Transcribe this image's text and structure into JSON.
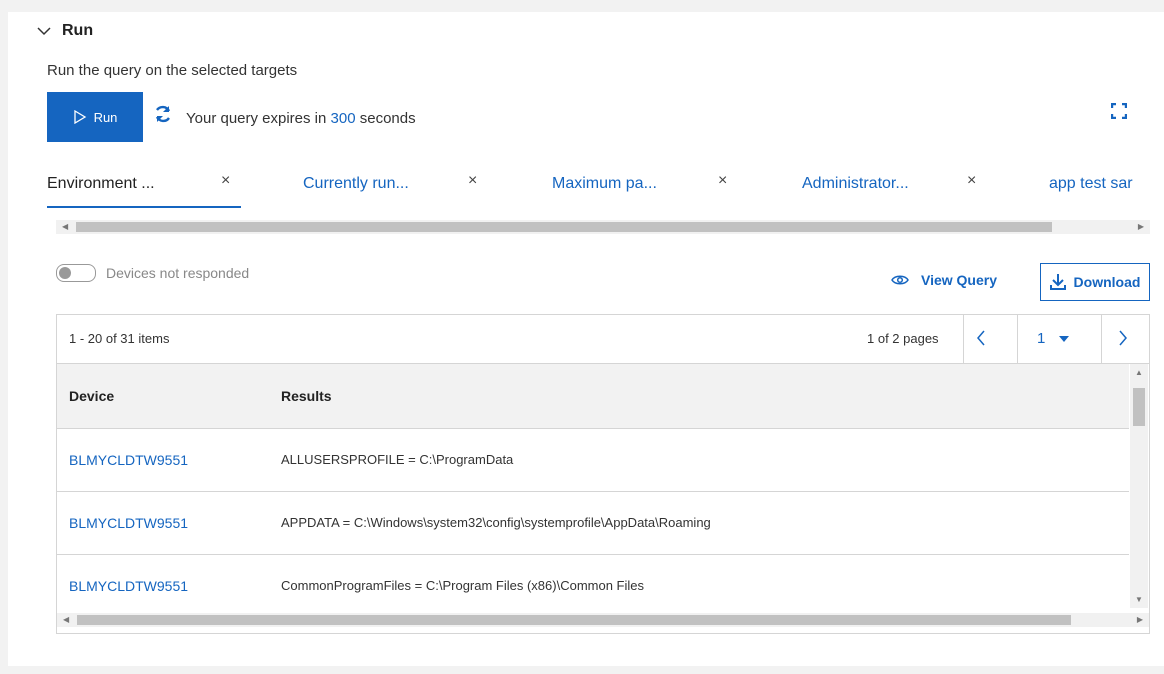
{
  "section": {
    "title": "Run",
    "subtitle": "Run the query on the selected targets"
  },
  "run_button": {
    "label": "Run"
  },
  "expiry": {
    "prefix": "Your query expires in",
    "seconds": "300",
    "suffix": "seconds"
  },
  "tabs": [
    {
      "label": "Environment ...",
      "close": "×",
      "active": true
    },
    {
      "label": "Currently run...",
      "close": "×",
      "active": false
    },
    {
      "label": "Maximum pa...",
      "close": "×",
      "active": false
    },
    {
      "label": "Administrator...",
      "close": "×",
      "active": false
    },
    {
      "label": "app test sar",
      "close": "",
      "active": false
    }
  ],
  "toggle": {
    "label": "Devices not responded",
    "on": false
  },
  "view_query": {
    "label": "View Query"
  },
  "download": {
    "label": "Download"
  },
  "pager": {
    "items": "1 - 20 of 31 items",
    "pages": "1 of 2 pages",
    "current_page": "1"
  },
  "table": {
    "columns": [
      "Device",
      "Results"
    ],
    "rows": [
      {
        "device": "BLMYCLDTW9551",
        "result": "ALLUSERSPROFILE = C:\\ProgramData"
      },
      {
        "device": "BLMYCLDTW9551",
        "result": "APPDATA = C:\\Windows\\system32\\config\\systemprofile\\AppData\\Roaming"
      },
      {
        "device": "BLMYCLDTW9551",
        "result": "CommonProgramFiles = C:\\Program Files (x86)\\Common Files"
      }
    ]
  },
  "colors": {
    "accent": "#1565c0",
    "header_bg": "#f2f2f2",
    "border": "#d5d5d5"
  },
  "icons": [
    "chevron-down-icon",
    "play-icon",
    "refresh-icon",
    "expand-icon",
    "close-icon",
    "eye-icon",
    "download-icon",
    "chevron-left-icon",
    "caret-down-icon",
    "chevron-right-icon"
  ]
}
